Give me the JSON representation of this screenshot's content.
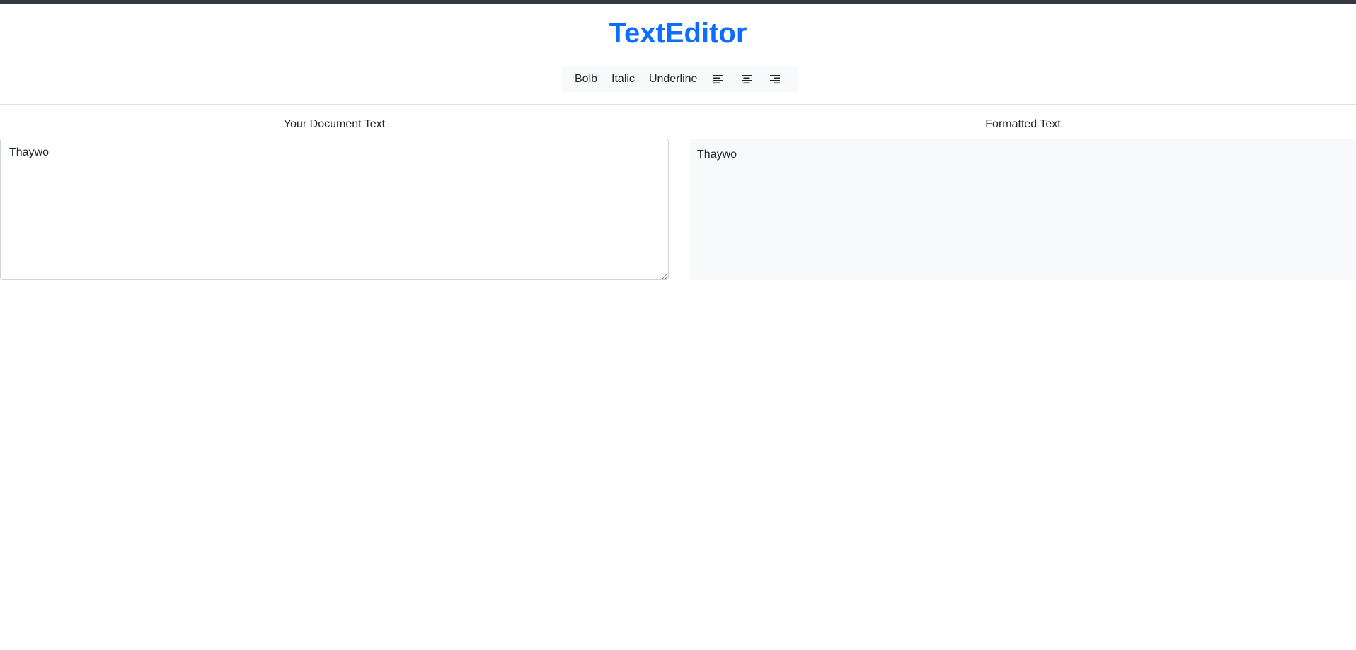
{
  "app": {
    "title": "TextEditor"
  },
  "toolbar": {
    "bold_label": "Bolb",
    "italic_label": "Italic",
    "underline_label": "Underline",
    "align_left_icon": "align-left-icon",
    "align_center_icon": "align-center-icon",
    "align_right_icon": "align-right-icon"
  },
  "editor": {
    "label": "Your Document Text",
    "value": "Thaywo"
  },
  "preview": {
    "label": "Formatted Text",
    "content": "Thaywo"
  },
  "colors": {
    "accent": "#0d6efd",
    "top_strip": "#343a40",
    "toolbar_bg": "#f8f9fa",
    "preview_bg": "#f8f9fa"
  }
}
